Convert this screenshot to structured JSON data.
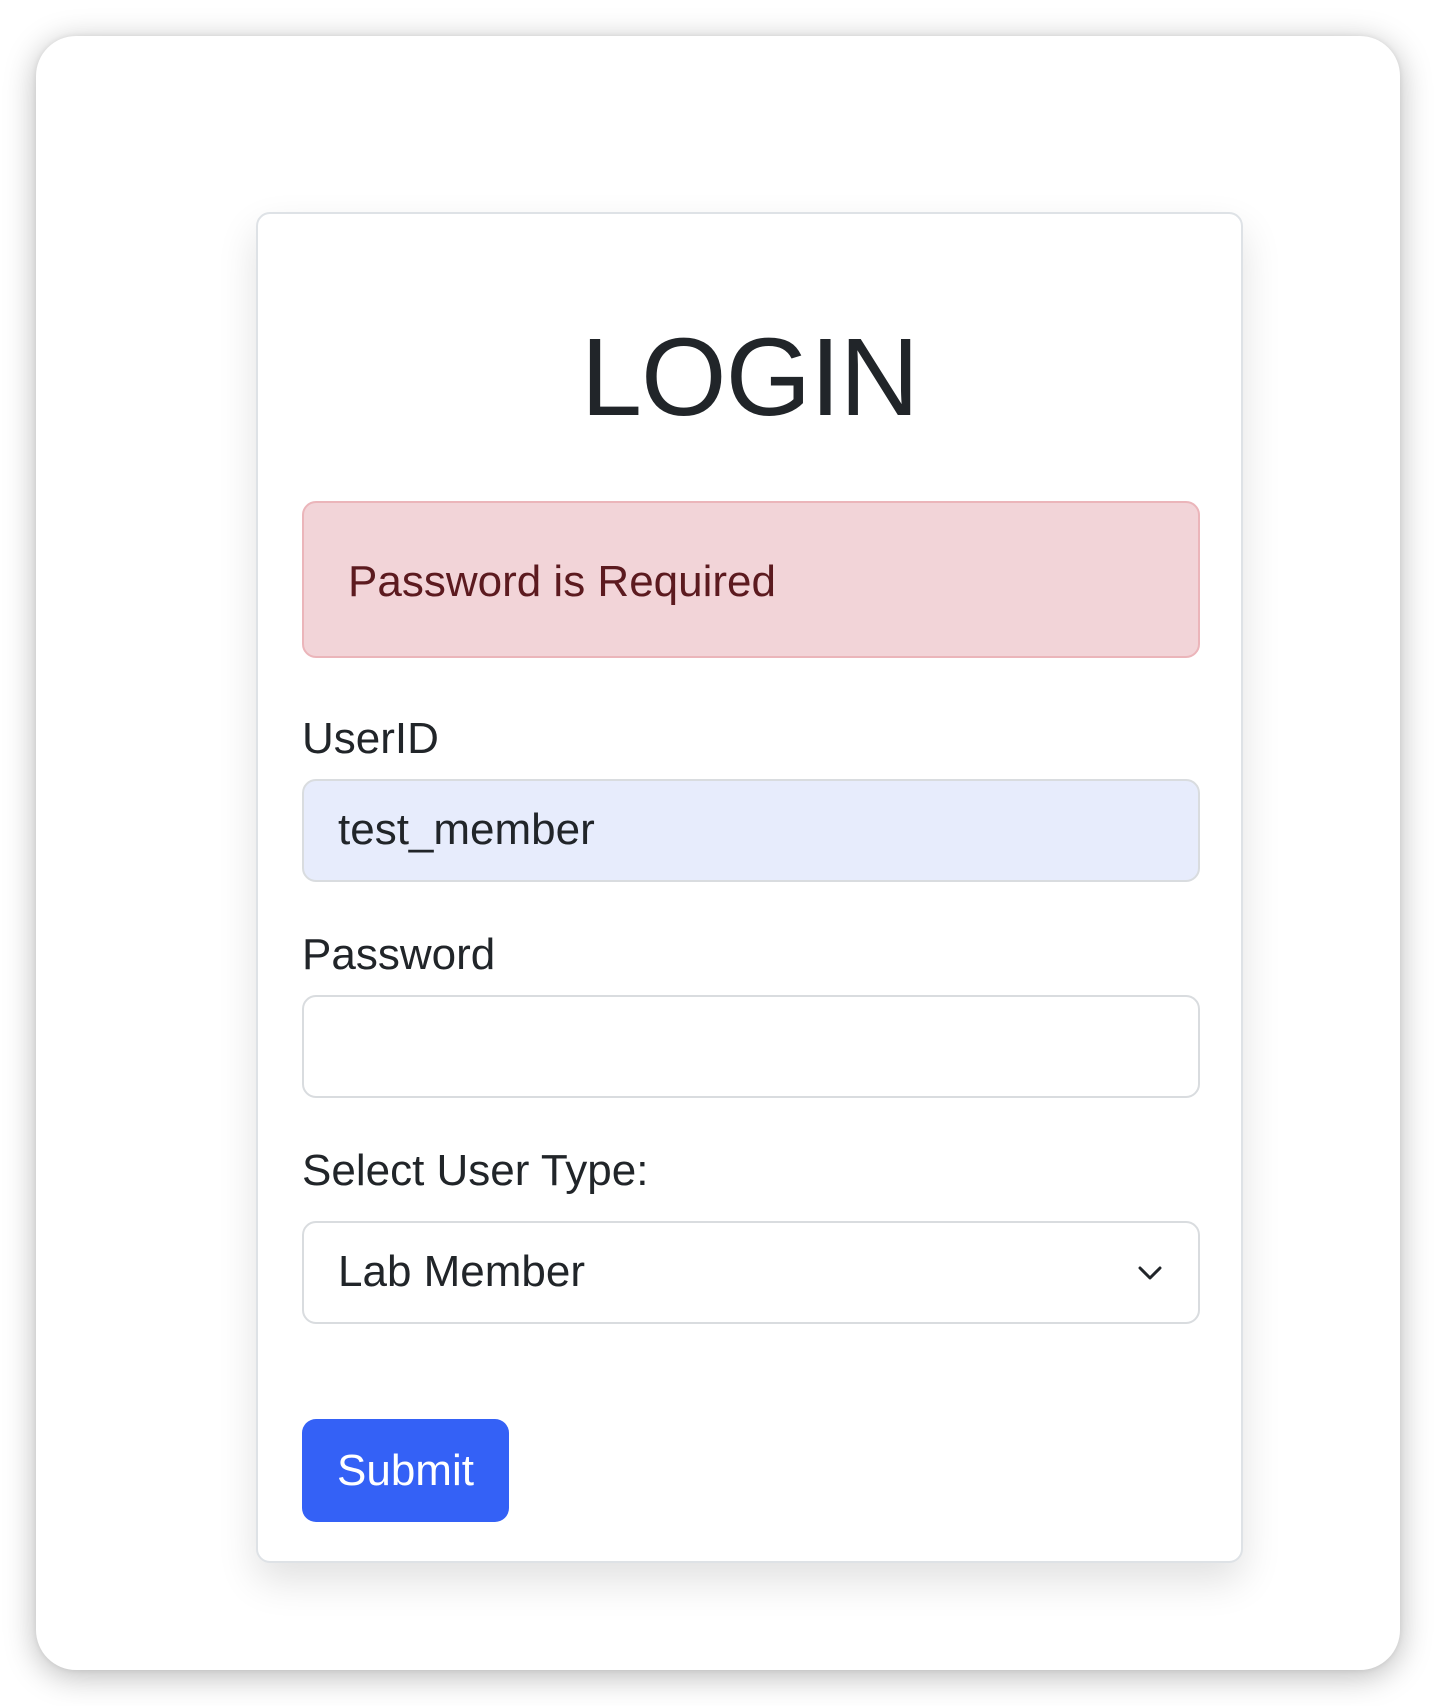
{
  "login": {
    "title": "LOGIN",
    "alert": "Password is Required",
    "userid_label": "UserID",
    "userid_value": "test_member",
    "password_label": "Password",
    "password_value": "",
    "usertype_label": "Select User Type:",
    "usertype_selected": "Lab Member",
    "submit_label": "Submit"
  },
  "colors": {
    "alert_bg": "#f2d4d8",
    "alert_text": "#5c1a1f",
    "autofill_bg": "#e7ecfc",
    "primary": "#3461f6"
  },
  "icons": {
    "select_indicator": "chevron-down-icon"
  }
}
